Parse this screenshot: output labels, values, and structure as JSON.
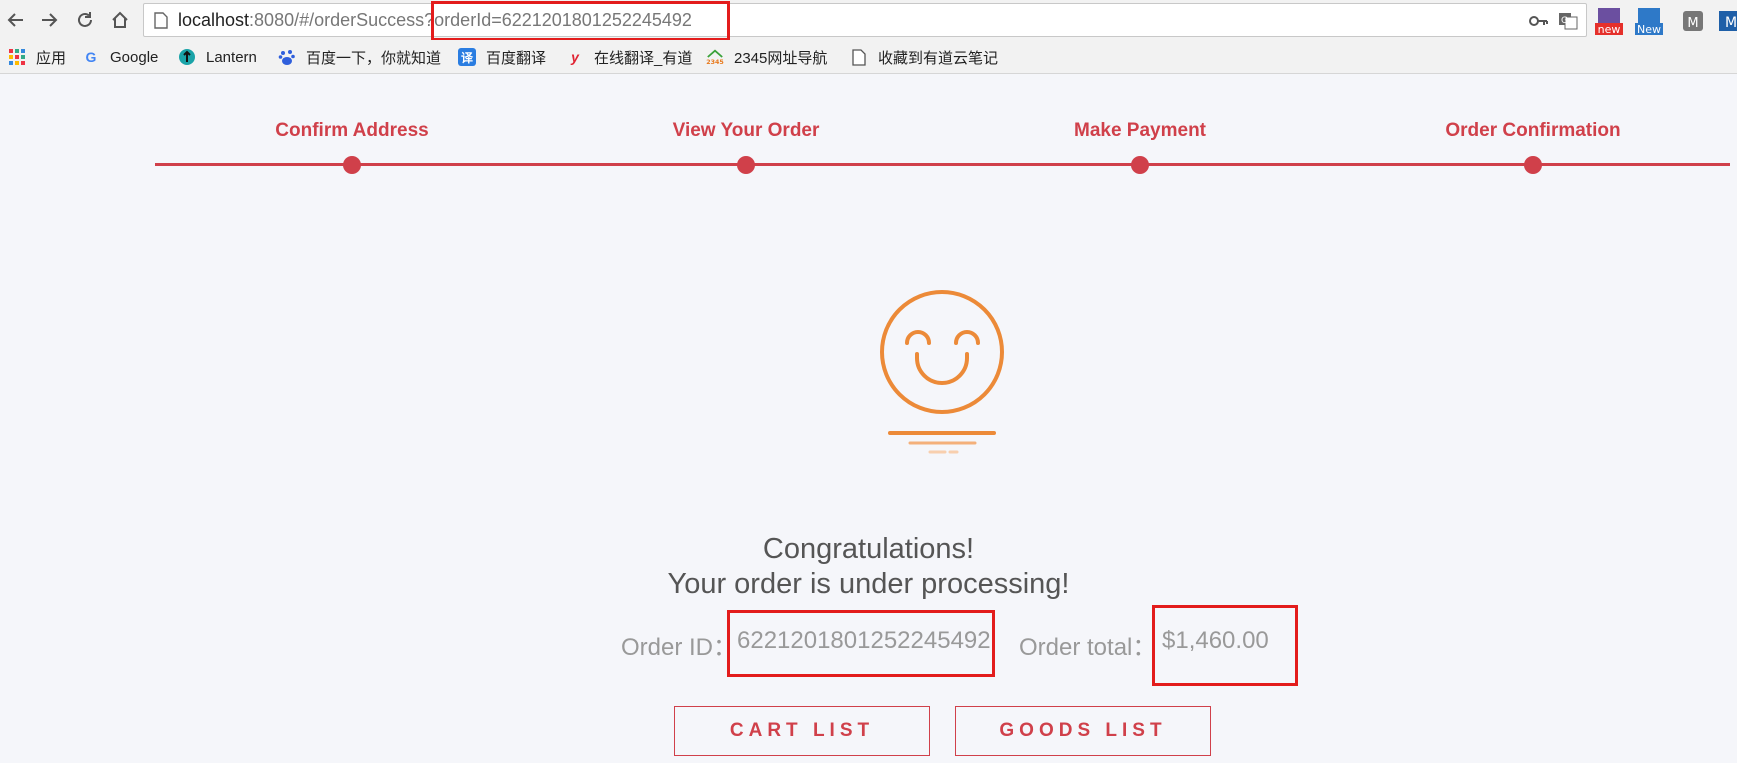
{
  "browser": {
    "url_host": "localhost",
    "url_path": ":8080/#/orderSuccess",
    "url_query": "?orderId=6221201801252245492",
    "extensions": [
      {
        "name": "extension-new-1",
        "badge": "new"
      },
      {
        "name": "extension-new-2",
        "badge": "New"
      },
      {
        "name": "extension-3",
        "badge": "M"
      },
      {
        "name": "extension-4",
        "badge": "M"
      }
    ]
  },
  "bookmarks": [
    {
      "label": "应用",
      "icon": "apps-grid-icon"
    },
    {
      "label": "Google",
      "icon": "google-icon"
    },
    {
      "label": "Lantern",
      "icon": "lantern-icon"
    },
    {
      "label": "百度一下，你就知道",
      "icon": "baidu-icon"
    },
    {
      "label": "百度翻译",
      "icon": "baidu-translate-icon"
    },
    {
      "label": "在线翻译_有道",
      "icon": "youdao-icon"
    },
    {
      "label": "2345网址导航",
      "icon": "2345-icon"
    },
    {
      "label": "收藏到有道云笔记",
      "icon": "page-icon"
    }
  ],
  "steps": [
    {
      "label": "Confirm Address"
    },
    {
      "label": "View Your Order"
    },
    {
      "label": "Make Payment"
    },
    {
      "label": "Order Confirmation"
    }
  ],
  "message": {
    "line1": "Congratulations!",
    "line2": "Your order is under processing!"
  },
  "order": {
    "id_label": "Order ID：",
    "id_value": "6221201801252245492",
    "total_label": "Order total：",
    "total_value": "$1,460.00"
  },
  "buttons": {
    "cart": "CART LIST",
    "goods": "GOODS LIST"
  },
  "colors": {
    "accent": "#d0404a",
    "smile": "#ec8a38",
    "annotation": "#e31c1c"
  }
}
